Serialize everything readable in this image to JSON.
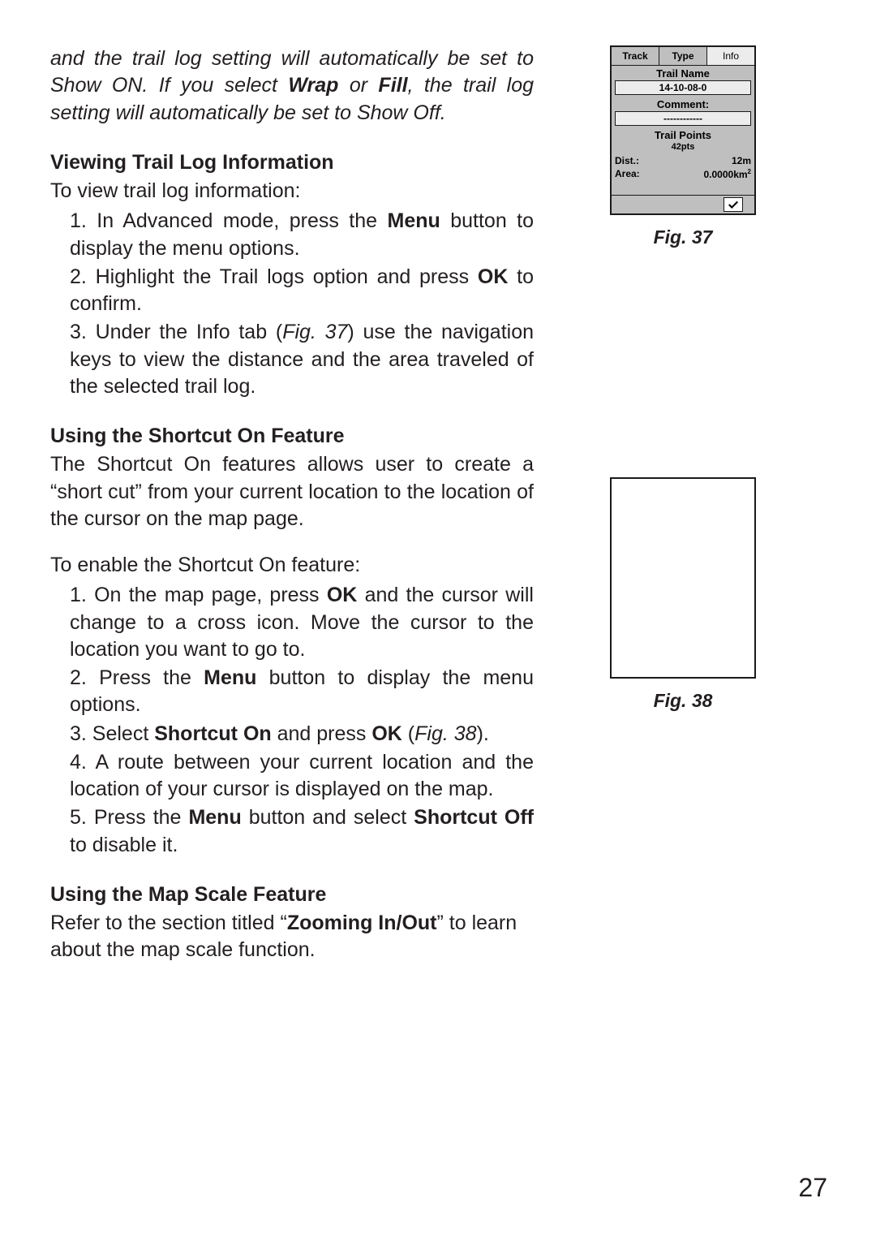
{
  "page_number": "27",
  "intro": {
    "pre": "and the trail log setting will automatically be set to Show ON. If you select ",
    "wrap": "Wrap",
    "mid": " or ",
    "fill": "Fill",
    "post": ", the trail log setting will automatically be set to Show Off."
  },
  "sec_view": {
    "heading": "Viewing Trail Log Information",
    "lead": "To view trail log information:",
    "step1_a": "1. In Advanced mode, press the ",
    "step1_b": "Menu",
    "step1_c": " button to display the menu options.",
    "step2_a": "2. Highlight the Trail logs option and press ",
    "step2_b": "OK",
    "step2_c": " to confirm.",
    "step3_a": "3. Under the Info tab (",
    "step3_fig": "Fig. 37",
    "step3_b": ") use the navigation keys to view the distance and the area traveled of the selected trail log."
  },
  "sec_shortcut": {
    "heading": "Using the Shortcut On Feature",
    "lead": "The Shortcut On features allows user to create a “short cut” from your current location to the location of the cursor on the map page.",
    "lead2": "To enable the Shortcut On feature:",
    "step1_a": "1. On the map page, press ",
    "step1_b": "OK",
    "step1_c": " and the cursor will change to a cross icon. Move the cursor to the location you want to go to.",
    "step2_a": "2. Press the ",
    "step2_b": "Menu",
    "step2_c": " button to display the menu options.",
    "step3_a": "3. Select ",
    "step3_b": "Shortcut On",
    "step3_c": " and press ",
    "step3_d": "OK",
    "step3_e": " (",
    "step3_fig": "Fig. 38",
    "step3_f": ").",
    "step4": "4. A route between your current location and the location of your cursor is displayed on the map.",
    "step5_a": "5. Press the ",
    "step5_b": "Menu",
    "step5_c": " button and select ",
    "step5_d": "Shortcut Off",
    "step5_e": " to disable it."
  },
  "sec_scale": {
    "heading": "Using the Map Scale Feature",
    "body_a": "Refer to the section titled “",
    "body_b": "Zooming In/Out",
    "body_c": "” to learn about the map scale function."
  },
  "fig37": {
    "caption": "Fig. 37",
    "tabs": {
      "track": "Track",
      "type": "Type",
      "info": "Info"
    },
    "trail_name_label": "Trail Name",
    "trail_name_value": "14-10-08-0",
    "comment_label": "Comment:",
    "comment_value": "------------",
    "trail_points_label": "Trail Points",
    "trail_points_value": "42pts",
    "dist_label": "Dist.:",
    "dist_value": "12m",
    "area_label": "Area:",
    "area_value": "0.0000km",
    "area_unit_sup": "2"
  },
  "fig38": {
    "caption": "Fig. 38"
  }
}
